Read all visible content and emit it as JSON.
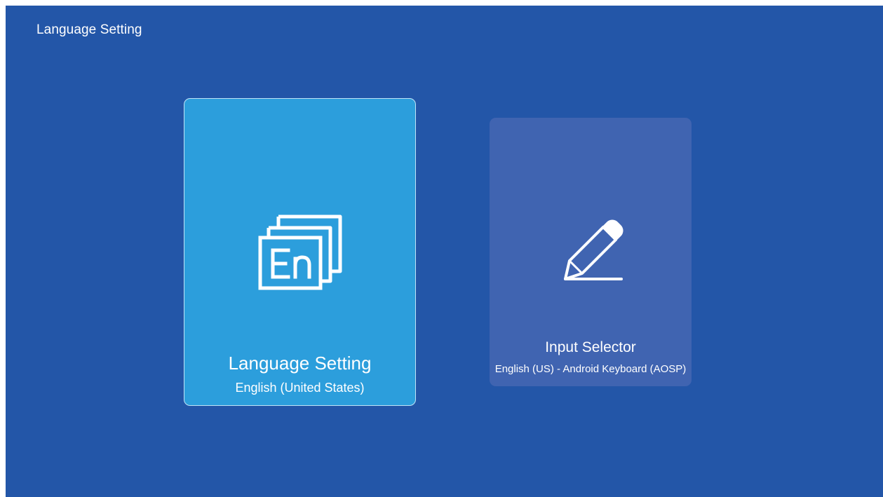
{
  "header": {
    "title": "Language Setting"
  },
  "cards": [
    {
      "title": "Language Setting",
      "subtitle": "English (United States)",
      "icon": "language-en-icon",
      "state": "focused"
    },
    {
      "title": "Input Selector",
      "subtitle": "English (US) - Android Keyboard (AOSP)",
      "icon": "pencil-icon",
      "state": "unfocused"
    }
  ],
  "colors": {
    "background": "#2356a8",
    "card_focused": "#2c9edc",
    "card_unfocused": "#4064b1",
    "text": "#ffffff"
  }
}
